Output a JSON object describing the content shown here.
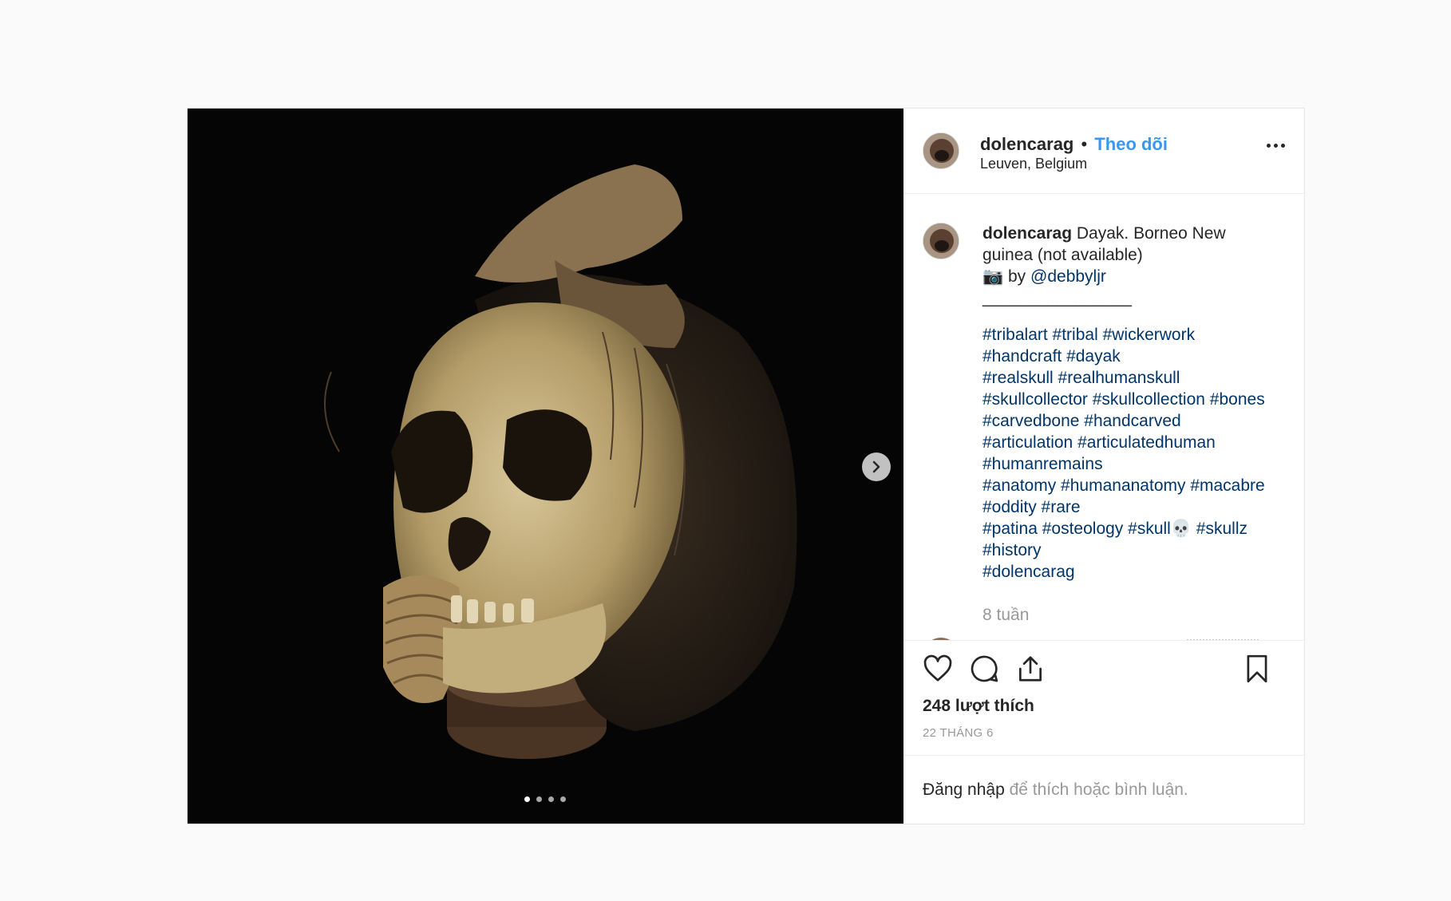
{
  "post": {
    "username": "dolencarag",
    "separator": "•",
    "follow_label": "Theo dõi",
    "location": "Leuven, Belgium",
    "more_icon": "more-horizontal-icon"
  },
  "media": {
    "current_slide": 1,
    "slide_count": 4,
    "next_icon": "chevron-right-icon"
  },
  "caption": {
    "username": "dolencarag",
    "line1": "Dayak. Borneo New",
    "line2": "guinea (not available)",
    "camera_emoji": "📷",
    "by_text": " by ",
    "mention": "@debbyljr",
    "divider": "________________",
    "hashtag_lines": [
      "#tribalart #tribal #wickerwork",
      "#handcraft #dayak",
      "#realskull #realhumanskull",
      "#skullcollector #skullcollection #bones",
      "#carvedbone #handcarved",
      "#articulation #articulatedhuman",
      "#humanremains",
      "#anatomy #humananatomy #macabre",
      "#oddity #rare",
      "#patina #osteology #skull💀 #skullz",
      "#history",
      "#dolencarag"
    ],
    "time_ago": "8 tuần"
  },
  "actions": {
    "like_icon": "heart-icon",
    "comment_icon": "comment-icon",
    "share_icon": "share-icon",
    "save_icon": "bookmark-icon",
    "likes_text": "248 lượt thích",
    "date": "22 THÁNG 6"
  },
  "login": {
    "link": "Đăng nhập",
    "rest": " để thích hoặc bình luận."
  }
}
